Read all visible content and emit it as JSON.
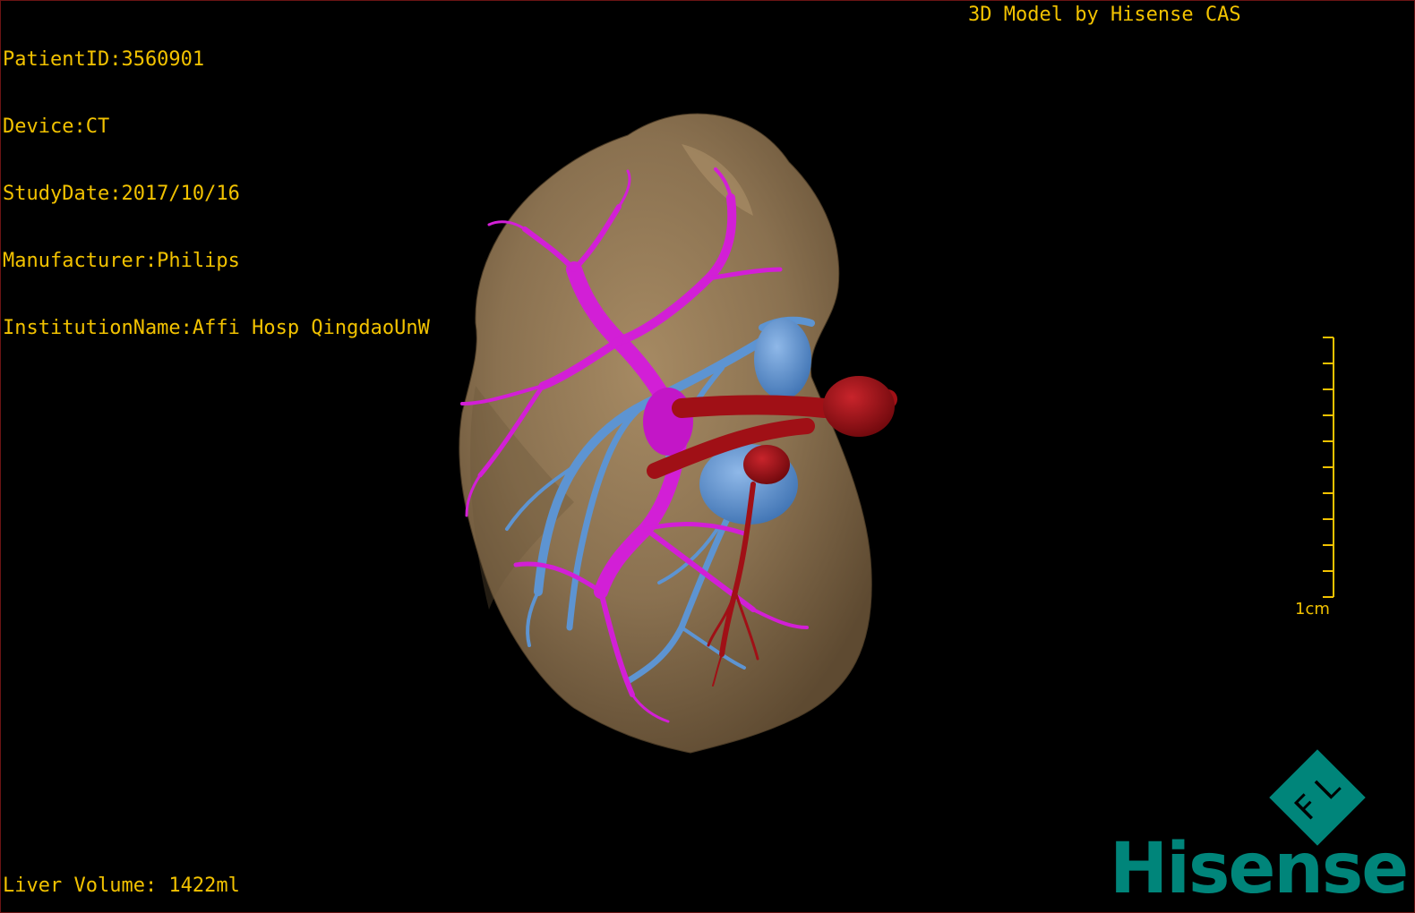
{
  "patient_info": {
    "patient_id": "PatientID:3560901",
    "device": "Device:CT",
    "study_date": "StudyDate:2017/10/16",
    "manufacturer": "Manufacturer:Philips",
    "institution": "InstitutionName:Affi Hosp QingdaoUnW"
  },
  "model_credit": "3D Model by Hisense CAS",
  "liver_volume": "Liver Volume: 1422ml",
  "scale_bar": {
    "label": "1cm",
    "tick_count": 10
  },
  "logo": {
    "wordmark": "Hisense",
    "emblem_letters": "F L"
  },
  "colors": {
    "overlay_text": "#f2c200",
    "liver_surface": "#8a7150",
    "portal_vein": "#d21fd6",
    "hepatic_vein": "#5d94d2",
    "hepatic_artery": "#a01016",
    "brand": "#00857a"
  },
  "icons": [
    "liver-model-render",
    "scale-bar",
    "hisense-fl-emblem"
  ]
}
